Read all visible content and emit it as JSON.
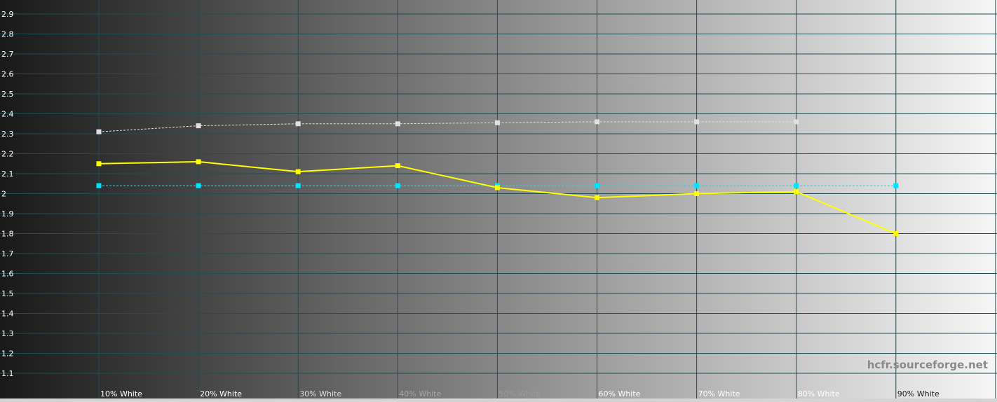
{
  "watermark": "hcfr.sourceforge.net",
  "chart_data": {
    "type": "line",
    "categories": [
      "10% White",
      "20% White",
      "30% White",
      "40% White",
      "50% White",
      "60% White",
      "70% White",
      "80% White",
      "90% White"
    ],
    "ylim": [
      1.0,
      3.0
    ],
    "yticks": [
      "1.1",
      "1.2",
      "1.3",
      "1.4",
      "1.5",
      "1.6",
      "1.7",
      "1.8",
      "1.9",
      "2",
      "2.1",
      "2.2",
      "2.3",
      "2.4",
      "2.5",
      "2.6",
      "2.7",
      "2.8",
      "2.9"
    ],
    "grid": true,
    "series": [
      {
        "values": [
          2.15,
          2.16,
          2.11,
          2.14,
          2.03,
          1.98,
          2.0,
          2.01,
          1.8
        ],
        "color": "#ffff00",
        "style": "solid"
      },
      {
        "values": [
          2.04,
          2.04,
          2.04,
          2.04,
          2.04,
          2.04,
          2.04,
          2.04,
          2.04
        ],
        "color": "#00e5ff",
        "style": "dashed"
      },
      {
        "values": [
          2.31,
          2.34,
          2.35,
          2.35,
          2.355,
          2.36,
          2.36,
          2.36,
          null
        ],
        "color": "#e0e0e0",
        "style": "dashed"
      }
    ]
  }
}
